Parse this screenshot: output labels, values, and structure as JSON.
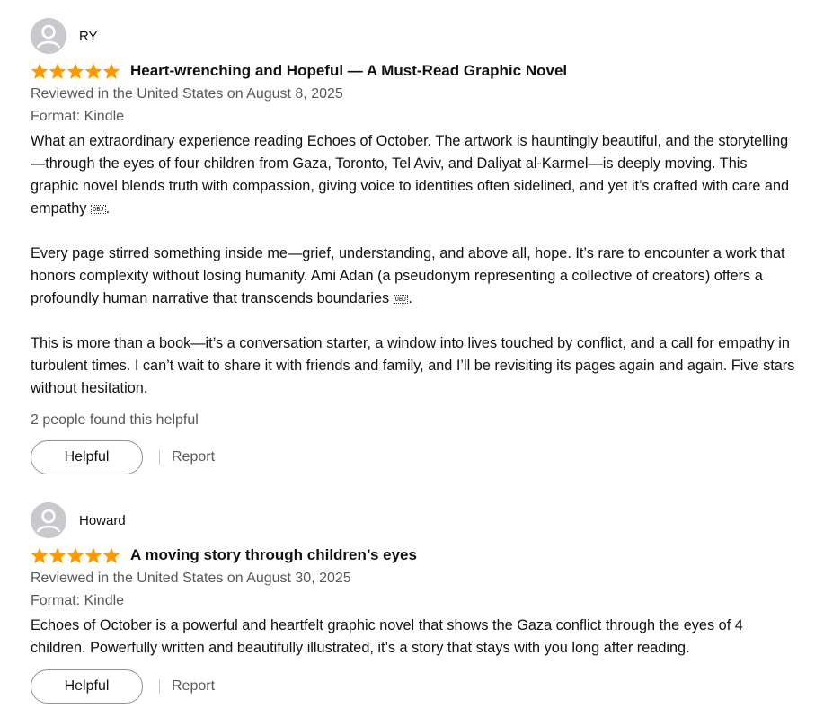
{
  "colors": {
    "star": "#ff9900",
    "text": "#0f1111",
    "muted": "#565959",
    "avatar_bg": "#c7c9cc"
  },
  "reviews": [
    {
      "profile_name": "RY",
      "rating": 5,
      "title": "Heart-wrenching and Hopeful — A Must-Read Graphic Novel",
      "date_line": "Reviewed in the United States on August 8, 2025",
      "format": "Format: Kindle",
      "paragraphs": [
        "What an extraordinary experience reading Echoes of October. The artwork is hauntingly beautiful, and the storytelling—through the eyes of four children from Gaza, Toronto, Tel Aviv, and Daliyat al-Karmel—is deeply moving. This graphic novel blends truth with compassion, giving voice to identities often sidelined, and yet it’s crafted with care and empathy",
        "Every page stirred something inside me—grief, understanding, and above all, hope. It’s rare to encounter a work that honors complexity without losing humanity. Ami Adan (a pseudonym representing a collective of creators) offers a profoundly human narrative that transcends boundaries",
        "This is more than a book—it’s a conversation starter, a window into lives touched by conflict, and a call for empathy in turbulent times. I can’t wait to share it with friends and family, and I’ll be revisiting its pages again and again. Five stars without hesitation."
      ],
      "obj_glyph": "OBJ",
      "helpful_count": "2 people found this helpful",
      "helpful_label": "Helpful",
      "report_label": "Report"
    },
    {
      "profile_name": "Howard",
      "rating": 5,
      "title": "A moving story through children’s eyes",
      "date_line": "Reviewed in the United States on August 30, 2025",
      "format": "Format: Kindle",
      "paragraphs": [
        "Echoes of October is a powerful and heartfelt graphic novel that shows the Gaza conflict through the eyes of 4 children. Powerfully written and beautifully illustrated, it’s a story that stays with you long after reading."
      ],
      "helpful_label": "Helpful",
      "report_label": "Report"
    }
  ]
}
